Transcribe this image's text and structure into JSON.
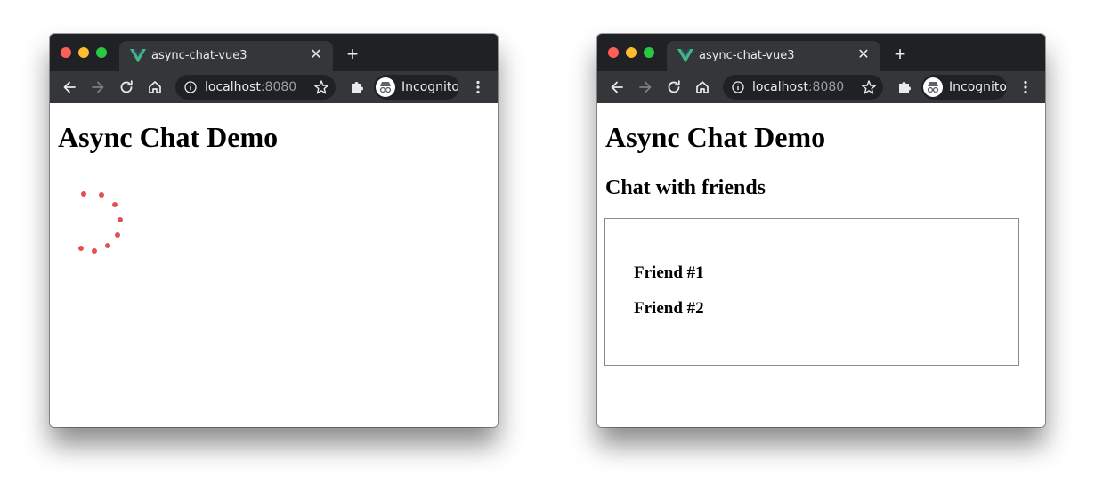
{
  "windows": [
    {
      "tab": {
        "title": "async-chat-vue3",
        "favicon": "vue-logo-icon"
      },
      "address": {
        "host": "localhost",
        "port": ":8080"
      },
      "profile": {
        "label": "Incognito",
        "icon": "incognito-icon"
      },
      "page": {
        "heading": "Async Chat Demo",
        "state": "loading"
      }
    },
    {
      "tab": {
        "title": "async-chat-vue3",
        "favicon": "vue-logo-icon"
      },
      "address": {
        "host": "localhost",
        "port": ":8080"
      },
      "profile": {
        "label": "Incognito",
        "icon": "incognito-icon"
      },
      "page": {
        "heading": "Async Chat Demo",
        "subheading": "Chat with friends",
        "friends": [
          "Friend #1",
          "Friend #2"
        ]
      }
    }
  ],
  "colors": {
    "chrome_dark": "#202124",
    "chrome_tab": "#35363a",
    "spinner_dot": "#e0524f",
    "vue_green": "#41b883",
    "vue_dark": "#34495e"
  }
}
